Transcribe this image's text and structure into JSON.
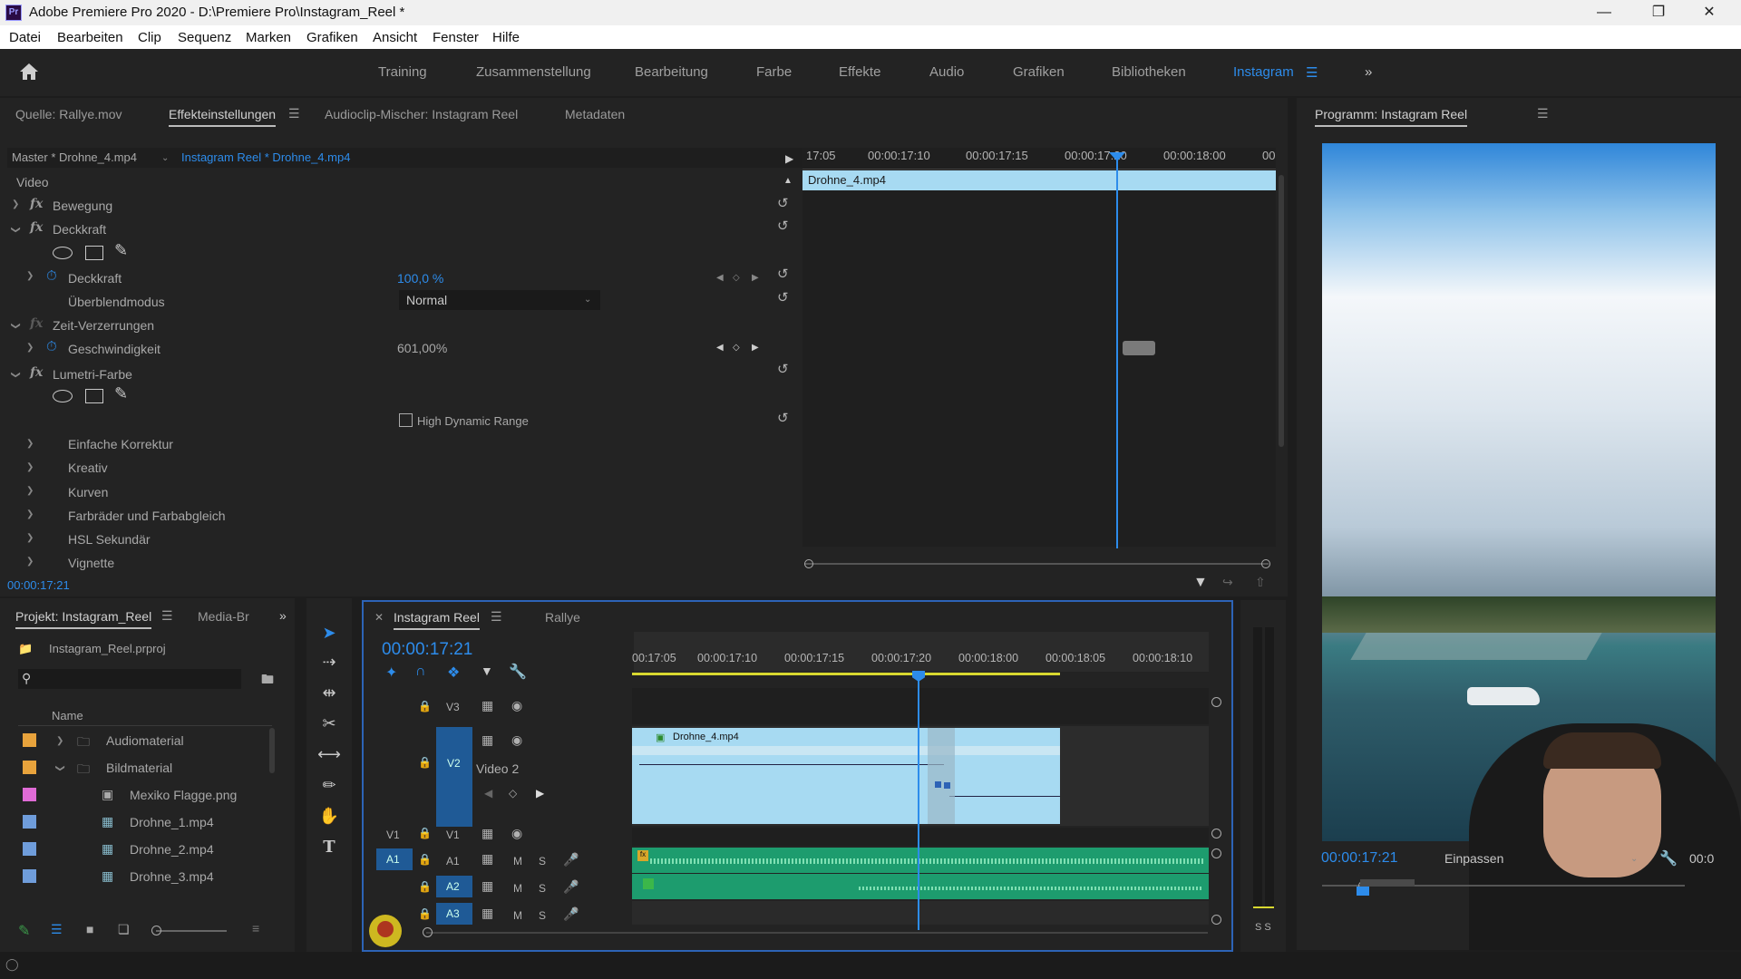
{
  "titlebar": {
    "title": "Adobe Premiere Pro 2020 - D:\\Premiere Pro\\Instagram_Reel *",
    "app_icon": "Pr"
  },
  "menubar": [
    "Datei",
    "Bearbeiten",
    "Clip",
    "Sequenz",
    "Marken",
    "Grafiken",
    "Ansicht",
    "Fenster",
    "Hilfe"
  ],
  "workspaces": [
    "Training",
    "Zusammenstellung",
    "Bearbeitung",
    "Farbe",
    "Effekte",
    "Audio",
    "Grafiken",
    "Bibliotheken",
    "Instagram"
  ],
  "active_workspace": "Instagram",
  "effect_panel": {
    "tabs": [
      "Quelle: Rallye.mov",
      "Effekteinstellungen",
      "Audioclip-Mischer: Instagram Reel",
      "Metadaten"
    ],
    "master": "Master * Drohne_4.mp4",
    "sequence_clip": "Instagram Reel * Drohne_4.mp4",
    "section_video": "Video",
    "rows": {
      "bewegung": "Bewegung",
      "deckkraft_group": "Deckkraft",
      "deckkraft_prop": "Deckkraft",
      "deckkraft_value": "100,0 %",
      "blend_label": "Überblendmodus",
      "blend_value": "Normal",
      "zeit": "Zeit-Verzerrungen",
      "speed_label": "Geschwindigkeit",
      "speed_value": "601,00%",
      "lumetri": "Lumetri-Farbe",
      "hdr": "High Dynamic Range",
      "einfache": "Einfache Korrektur",
      "kreativ": "Kreativ",
      "kurven": "Kurven",
      "farbraeder": "Farbräder und Farbabgleich",
      "hsl": "HSL Sekundär",
      "vignette": "Vignette"
    },
    "ruler": [
      "17:05",
      "00:00:17:10",
      "00:00:17:15",
      "00:00:17:20",
      "00:00:18:00",
      "00"
    ],
    "clip_name": "Drohne_4.mp4",
    "timecode": "00:00:17:21"
  },
  "program_monitor": {
    "title": "Programm: Instagram Reel",
    "timecode": "00:00:17:21",
    "fit": "Einpassen",
    "right_tc": "00:0"
  },
  "project_panel": {
    "tabs": [
      "Projekt: Instagram_Reel",
      "Media-Br"
    ],
    "file": "Instagram_Reel.prproj",
    "column": "Name",
    "items": [
      {
        "name": "Audiomaterial",
        "type": "folder",
        "color": "#e8a33c"
      },
      {
        "name": "Bildmaterial",
        "type": "folder",
        "color": "#e8a33c"
      },
      {
        "name": "Mexiko Flagge.png",
        "type": "image",
        "color": "#e06bd6"
      },
      {
        "name": "Drohne_1.mp4",
        "type": "video",
        "color": "#6f9ddb"
      },
      {
        "name": "Drohne_2.mp4",
        "type": "video",
        "color": "#6f9ddb"
      },
      {
        "name": "Drohne_3.mp4",
        "type": "video",
        "color": "#6f9ddb"
      }
    ]
  },
  "timeline": {
    "tabs": [
      "Instagram Reel",
      "Rallye"
    ],
    "timecode": "00:00:17:21",
    "ruler": [
      "00:17:05",
      "00:00:17:10",
      "00:00:17:15",
      "00:00:17:20",
      "00:00:18:00",
      "00:00:18:05",
      "00:00:18:10"
    ],
    "tracks": {
      "v3": "V3",
      "v2": "V2",
      "v2_name": "Video 2",
      "v1": "V1",
      "v1_src": "V1",
      "a1": "A1",
      "a1_src": "A1",
      "a2": "A2",
      "a3": "A3",
      "m": "M",
      "s": "S"
    },
    "clip_name": "Drohne_4.mp4",
    "meter_labels": "S S"
  },
  "colors": {
    "accent": "#2d8ceb",
    "clip_video": "#a7daf2",
    "clip_audio": "#1d9c6e",
    "panel_bg": "#232323"
  }
}
